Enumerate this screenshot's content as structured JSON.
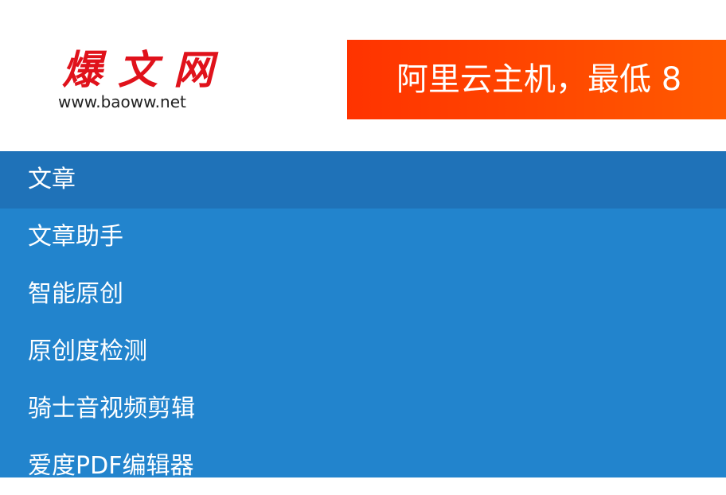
{
  "header": {
    "logo": {
      "title": "爆文网",
      "url": "www.baoww.net"
    },
    "banner": {
      "text": "阿里云主机，最低 8"
    }
  },
  "nav": {
    "items": [
      {
        "label": "文章",
        "active": true
      },
      {
        "label": "文章助手"
      },
      {
        "label": "智能原创"
      },
      {
        "label": "原创度检测"
      },
      {
        "label": "骑士音视频剪辑"
      },
      {
        "label": "爱度PDF编辑器"
      }
    ]
  },
  "colors": {
    "logo_red": "#e0121b",
    "banner_orange": "#ff3300",
    "nav_blue": "#2284cd",
    "nav_active_blue": "#1f72b8"
  }
}
